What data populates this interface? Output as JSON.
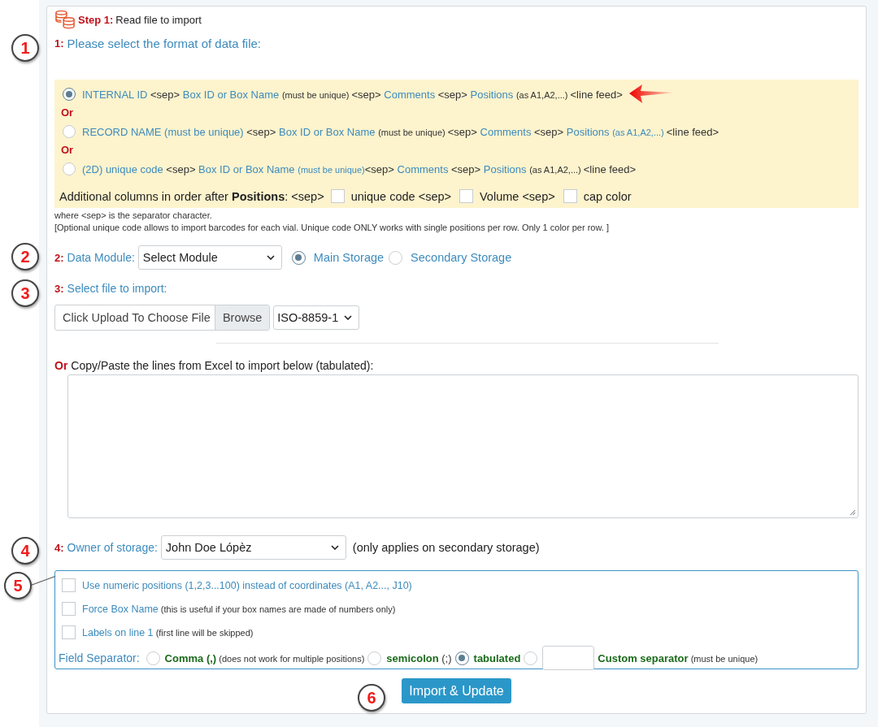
{
  "step_header": {
    "title": "Step 1:",
    "subtitle": "Read file to import"
  },
  "format_section": {
    "number": "1:",
    "label": "Please select the format of data file:",
    "options": [
      {
        "selected": true,
        "highlighted": true,
        "parts": [
          {
            "kind": "field",
            "text": "INTERNAL ID "
          },
          {
            "kind": "plain",
            "text": "<sep> "
          },
          {
            "kind": "field",
            "text": "Box ID or Box Name "
          },
          {
            "kind": "note",
            "text": "(must be unique) "
          },
          {
            "kind": "plain",
            "text": "<sep> "
          },
          {
            "kind": "field",
            "text": "Comments "
          },
          {
            "kind": "plain",
            "text": "<sep> "
          },
          {
            "kind": "field",
            "text": "Positions "
          },
          {
            "kind": "note",
            "text": "(as A1,A2,...) "
          },
          {
            "kind": "plain",
            "text": "<line feed>"
          }
        ]
      },
      {
        "selected": false,
        "highlighted": false,
        "prefix": "Or",
        "parts": [
          {
            "kind": "field",
            "text": "RECORD NAME (must be unique) "
          },
          {
            "kind": "plain",
            "text": "<sep> "
          },
          {
            "kind": "field",
            "text": "Box ID or Box Name "
          },
          {
            "kind": "note",
            "text": "(must be unique) "
          },
          {
            "kind": "plain",
            "text": "<sep> "
          },
          {
            "kind": "field",
            "text": "Comments "
          },
          {
            "kind": "plain",
            "text": "<sep> "
          },
          {
            "kind": "field",
            "text": "Positions "
          },
          {
            "kind": "fieldnote",
            "text": "(as A1,A2,...) "
          },
          {
            "kind": "plain",
            "text": "<line feed>"
          }
        ]
      },
      {
        "selected": false,
        "highlighted": false,
        "prefix": "Or",
        "parts": [
          {
            "kind": "field",
            "text": "(2D) unique code "
          },
          {
            "kind": "plain",
            "text": "<sep> "
          },
          {
            "kind": "field",
            "text": "Box ID or Box Name "
          },
          {
            "kind": "fieldnote",
            "text": "(must be unique)"
          },
          {
            "kind": "plain",
            "text": "<sep> "
          },
          {
            "kind": "field",
            "text": "Comments "
          },
          {
            "kind": "plain",
            "text": "<sep> "
          },
          {
            "kind": "field",
            "text": "Positions "
          },
          {
            "kind": "note",
            "text": "(as A1,A2,...) "
          },
          {
            "kind": "plain",
            "text": "<line feed>"
          }
        ]
      }
    ],
    "additional_label": "Additional columns in order after **Positions**: <sep>",
    "additional_columns": [
      {
        "label": "unique code <sep>",
        "checked": false
      },
      {
        "label": "Volume <sep>",
        "checked": false
      },
      {
        "label": "cap color",
        "checked": false
      }
    ],
    "notes": [
      "where <sep> is the separator character.",
      "[Optional unique code allows to import barcodes for each vial. Unique code ONLY works with single positions per row. Only 1 color per row. ]"
    ]
  },
  "module_section": {
    "number": "2:",
    "label": "Data Module:",
    "select_value": "Select Module",
    "storage_options": [
      {
        "label": "Main Storage",
        "selected": true
      },
      {
        "label": "Secondary Storage",
        "selected": false
      }
    ]
  },
  "file_section": {
    "number": "3:",
    "label": "Select file to import:",
    "file_placeholder": "Click Upload To Choose File",
    "browse_button": "Browse",
    "encoding": "ISO-8859-1"
  },
  "paste_section": {
    "prefix": "Or",
    "label": "Copy/Paste the lines from Excel to import below (tabulated):"
  },
  "owner_section": {
    "number": "4:",
    "label": "Owner of storage:",
    "select_value": "John Doe Lópèz",
    "note": "(only applies on secondary storage)"
  },
  "options_box": {
    "checkboxes": [
      {
        "label": "Use numeric positions (1,2,3...100) instead of coordinates (A1, A2..., J10)",
        "checked": false
      },
      {
        "label": "Force Box Name",
        "note": "(this is useful if your box names are made of numbers only)",
        "checked": false
      },
      {
        "label": "Labels on line 1",
        "note": "(first line will be skipped)",
        "checked": false
      }
    ],
    "separator_label": "Field Separator:",
    "separators": [
      {
        "kind": "radio",
        "label": "Comma (,)",
        "note": "(does not work for multiple positions)",
        "selected": false
      },
      {
        "kind": "radio",
        "label": "semicolon",
        "note": "(;)",
        "selected": false
      },
      {
        "kind": "radio",
        "label": "tabulated",
        "selected": true
      },
      {
        "kind": "custom",
        "label": "Custom separator",
        "note": "(must be unique)",
        "selected": false
      }
    ]
  },
  "submit_button": "Import & Update",
  "callouts": [
    "1",
    "2",
    "3",
    "4",
    "5",
    "6"
  ]
}
